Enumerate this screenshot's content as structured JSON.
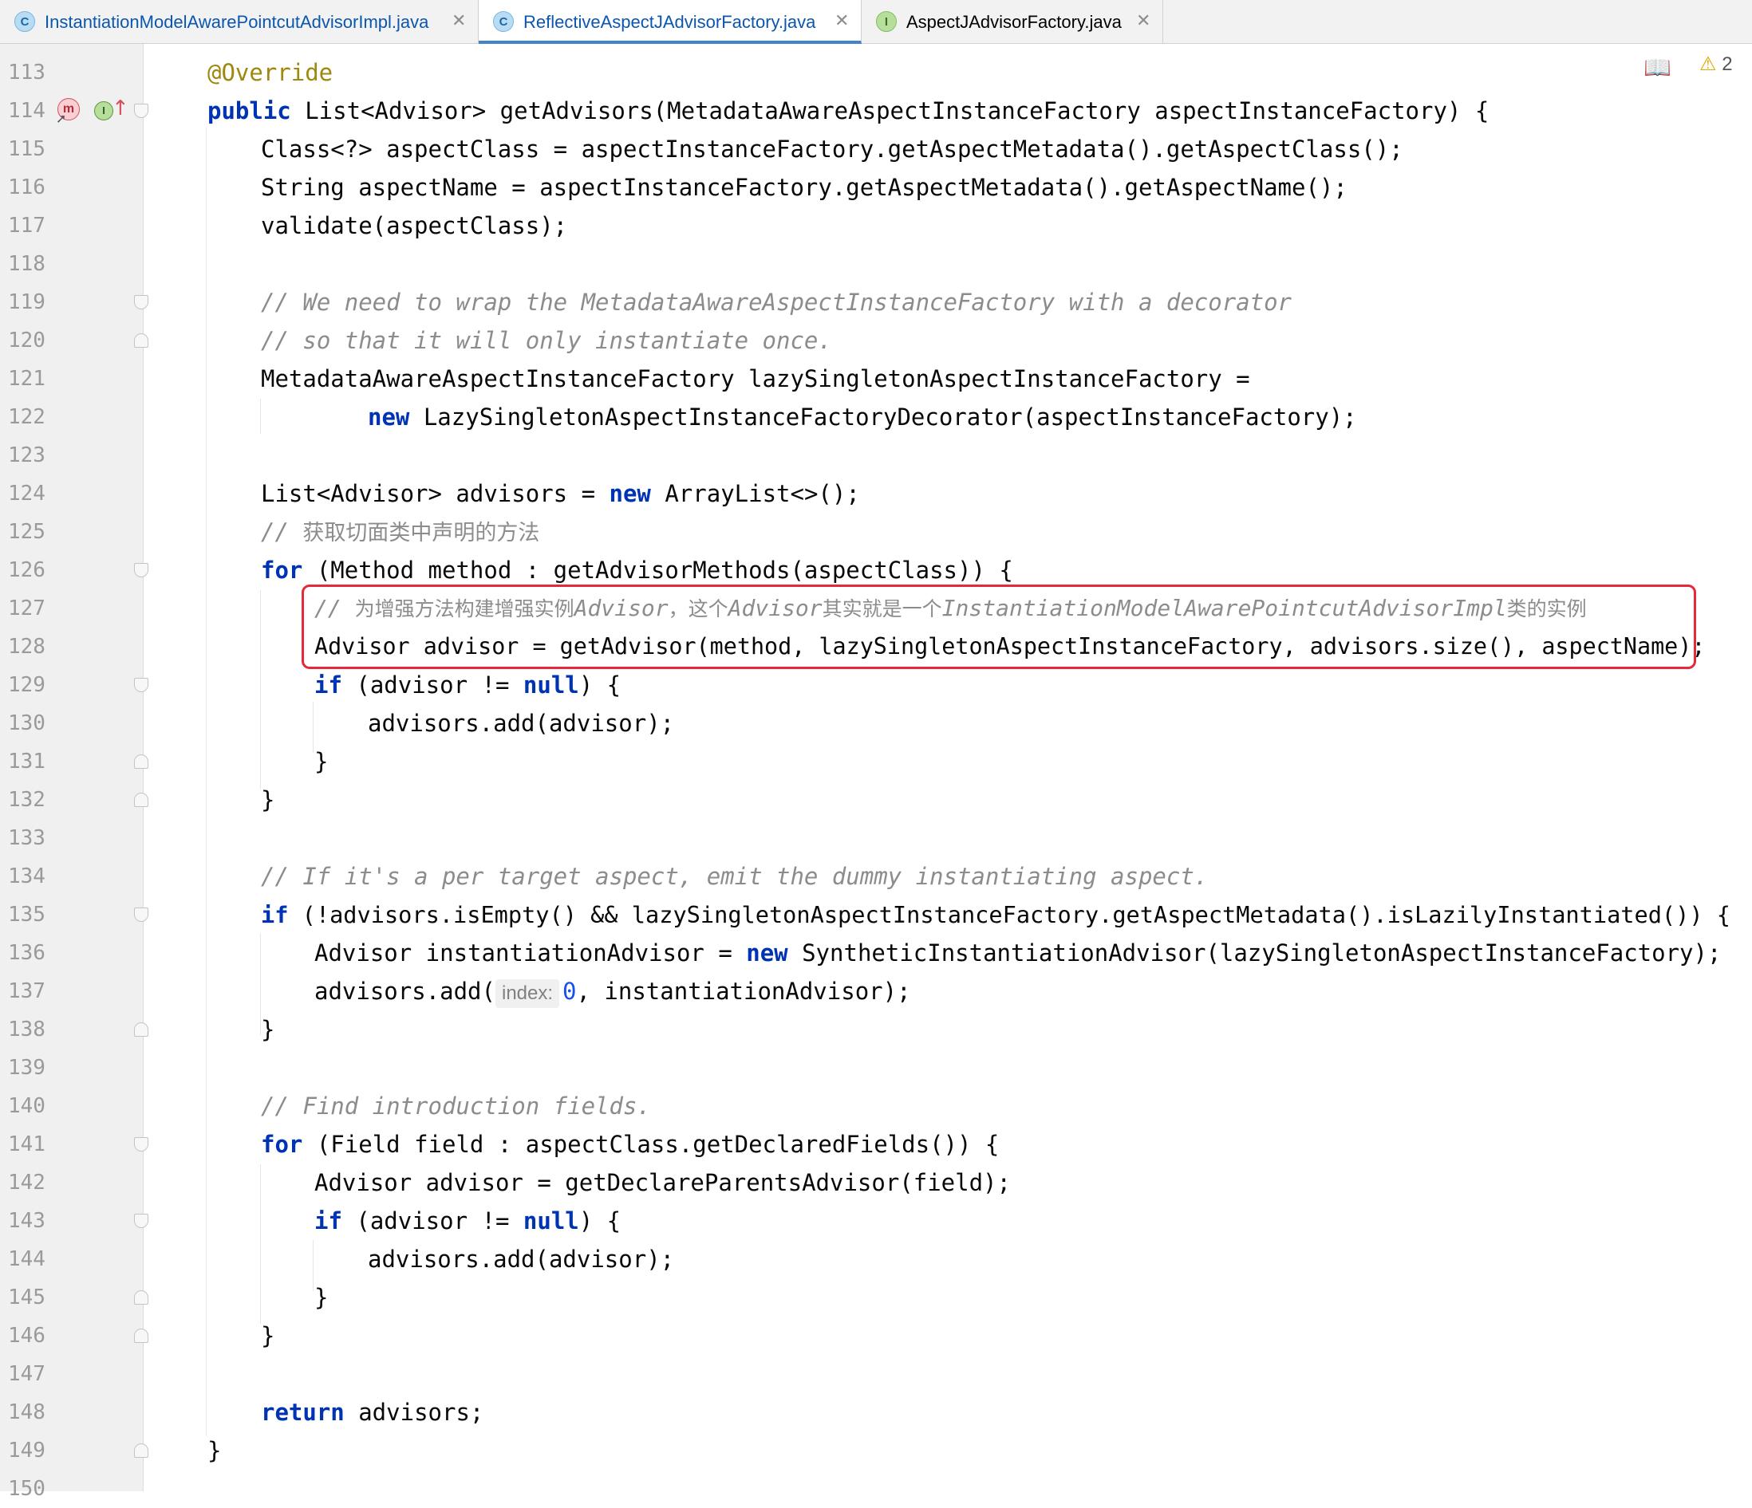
{
  "tabs": [
    {
      "label": "InstantiationModelAwarePointcutAdvisorImpl.java",
      "kind": "C",
      "active": false
    },
    {
      "label": "ReflectiveAspectJAdvisorFactory.java",
      "kind": "C",
      "active": true
    },
    {
      "label": "AspectJAdvisorFactory.java",
      "kind": "I",
      "active": false
    }
  ],
  "close_glyph": "✕",
  "gutter_icons": {
    "override_marker": "m",
    "implements_marker": "I"
  },
  "inspections": {
    "reader_mode_icon": "book-icon",
    "warning_count": "2"
  },
  "param_hint": "index:",
  "lines": [
    {
      "n": "113"
    },
    {
      "n": "114"
    },
    {
      "n": "115"
    },
    {
      "n": "116"
    },
    {
      "n": "117"
    },
    {
      "n": "118"
    },
    {
      "n": "119"
    },
    {
      "n": "120"
    },
    {
      "n": "121"
    },
    {
      "n": "122"
    },
    {
      "n": "123"
    },
    {
      "n": "124"
    },
    {
      "n": "125"
    },
    {
      "n": "126"
    },
    {
      "n": "127"
    },
    {
      "n": "128"
    },
    {
      "n": "129"
    },
    {
      "n": "130"
    },
    {
      "n": "131"
    },
    {
      "n": "132"
    },
    {
      "n": "133"
    },
    {
      "n": "134"
    },
    {
      "n": "135"
    },
    {
      "n": "136"
    },
    {
      "n": "137"
    },
    {
      "n": "138"
    },
    {
      "n": "139"
    },
    {
      "n": "140"
    },
    {
      "n": "141"
    },
    {
      "n": "142"
    },
    {
      "n": "143"
    },
    {
      "n": "144"
    },
    {
      "n": "145"
    },
    {
      "n": "146"
    },
    {
      "n": "147"
    },
    {
      "n": "148"
    },
    {
      "n": "149"
    },
    {
      "n": "150"
    }
  ],
  "code": {
    "l113": {
      "ann": "@Override"
    },
    "l114": {
      "kw": "public",
      "rest": " List<Advisor> getAdvisors(MetadataAwareAspectInstanceFactory aspectInstanceFactory) {"
    },
    "l115": "Class<?> aspectClass = aspectInstanceFactory.getAspectMetadata().getAspectClass();",
    "l116": "String aspectName = aspectInstanceFactory.getAspectMetadata().getAspectName();",
    "l117": "validate(aspectClass);",
    "l119": "// We need to wrap the MetadataAwareAspectInstanceFactory with a decorator",
    "l120": "// so that it will only instantiate once.",
    "l121": "MetadataAwareAspectInstanceFactory lazySingletonAspectInstanceFactory =",
    "l122": {
      "kw": "new",
      "rest": " LazySingletonAspectInstanceFactoryDecorator(aspectInstanceFactory);"
    },
    "l124": {
      "pre": "List<Advisor> advisors = ",
      "kw": "new",
      "rest": " ArrayList<>();"
    },
    "l125": {
      "slashes": "// ",
      "cn": "获取切面类中声明的方法"
    },
    "l126": {
      "kw": "for",
      "rest": " (Method method : getAdvisorMethods(aspectClass)) {"
    },
    "l127": {
      "slashes": "// ",
      "cn1": "为增强方法构建增强实例",
      "it1": "Advisor",
      "cn2": "，这个",
      "it2": "Advisor",
      "cn3": "其实就是一个",
      "it3": "InstantiationModelAwarePointcutAdvisorImpl",
      "cn4": "类的实例"
    },
    "l128": "Advisor advisor = getAdvisor(method, lazySingletonAspectInstanceFactory, advisors.size(), aspectName);",
    "l129": {
      "kw": "if",
      "mid": " (advisor != ",
      "kw2": "null",
      "rest": ") {"
    },
    "l130": "advisors.add(advisor);",
    "l131": "}",
    "l132": "}",
    "l134": "// If it's a per target aspect, emit the dummy instantiating aspect.",
    "l135": {
      "kw": "if",
      "rest": " (!advisors.isEmpty() && lazySingletonAspectInstanceFactory.getAspectMetadata().isLazilyInstantiated()) {"
    },
    "l136": {
      "pre": "Advisor instantiationAdvisor = ",
      "kw": "new",
      "rest": " SyntheticInstantiationAdvisor(lazySingletonAspectInstanceFactory);"
    },
    "l137": {
      "pre": "advisors.add(",
      "num": "0",
      "rest": ", instantiationAdvisor);"
    },
    "l138": "}",
    "l140": "// Find introduction fields.",
    "l141": {
      "kw": "for",
      "rest": " (Field field : aspectClass.getDeclaredFields()) {"
    },
    "l142": "Advisor advisor = getDeclareParentsAdvisor(field);",
    "l143": {
      "kw": "if",
      "mid": " (advisor != ",
      "kw2": "null",
      "rest": ") {"
    },
    "l144": "advisors.add(advisor);",
    "l145": "}",
    "l146": "}",
    "l148": {
      "kw": "return",
      "rest": " advisors;"
    },
    "l149": "}"
  },
  "colors": {
    "keyword": "#0033b3",
    "annotation": "#9e880d",
    "comment": "#8c8c8c",
    "number": "#1750eb",
    "highlight_box": "#e5283c",
    "active_tab_underline": "#4083c9"
  }
}
